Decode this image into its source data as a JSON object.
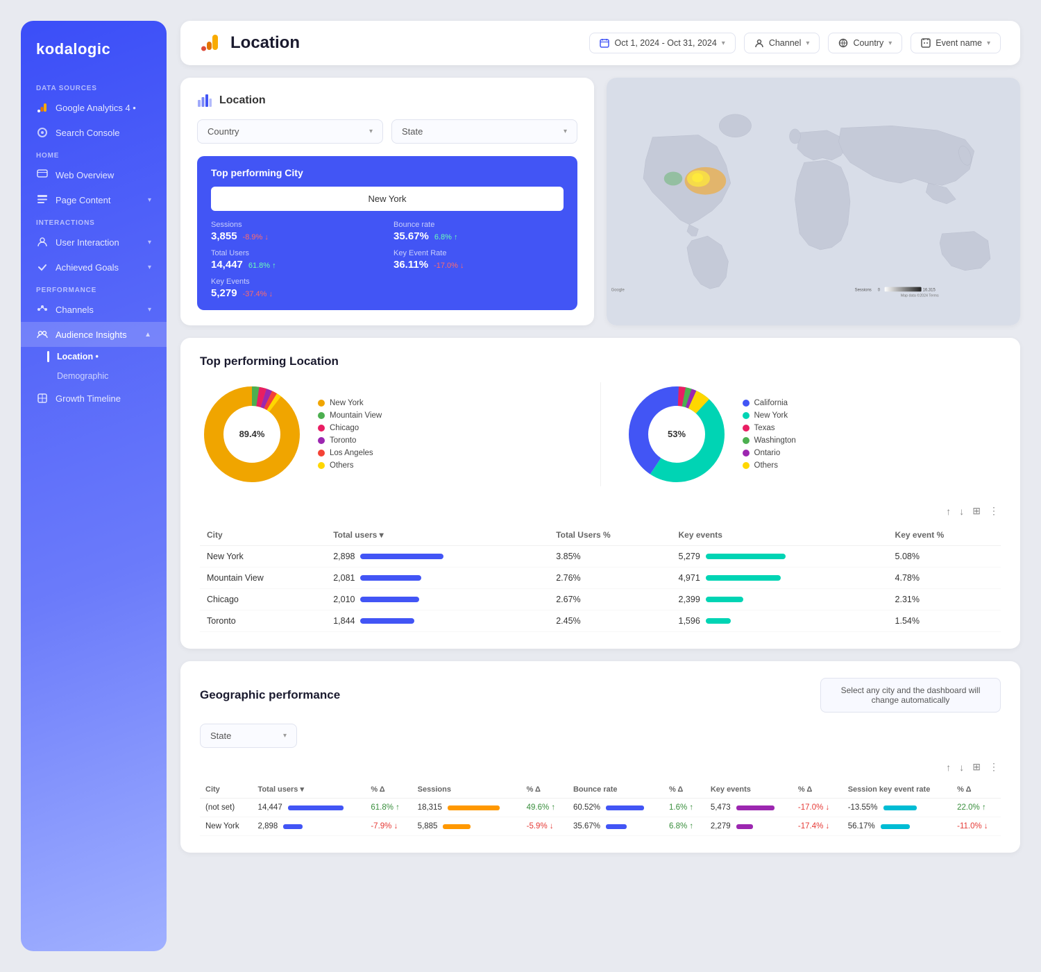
{
  "brand": "kodalogic",
  "sidebar": {
    "data_sources_label": "Data Sources",
    "google_analytics": "Google Analytics 4 •",
    "search_console": "Search Console",
    "home_label": "Home",
    "web_overview": "Web Overview",
    "page_content": "Page Content",
    "interactions_label": "Interactions",
    "user_interaction": "User Interaction",
    "achieved_goals": "Achieved Goals",
    "performance_label": "Performance",
    "channels": "Channels",
    "audience_insights": "Audience Insights",
    "location": "Location •",
    "demographic": "Demographic",
    "growth_timeline": "Growth Timeline"
  },
  "topbar": {
    "title": "Location",
    "filter_date": "Oct 1, 2024 - Oct 31, 2024",
    "filter_channel": "Channel",
    "filter_country": "Country",
    "filter_event": "Event name"
  },
  "location_card": {
    "title": "Location",
    "filter1": "Country",
    "filter2": "State",
    "top_city_label": "Top performing City",
    "city_name": "New York",
    "stats": [
      {
        "label": "Sessions",
        "value": "3,855",
        "change": "-8.9%",
        "dir": "down"
      },
      {
        "label": "Bounce rate",
        "value": "35.67%",
        "change": "6.8%",
        "dir": "up"
      },
      {
        "label": "Total Users",
        "value": "14,447",
        "change": "61.8%",
        "dir": "up"
      },
      {
        "label": "Key Event Rate",
        "value": "36.11%",
        "change": "-17.0%",
        "dir": "down"
      },
      {
        "label": "Key Events",
        "value": "5,279",
        "change": "-37.4%",
        "dir": "down"
      }
    ]
  },
  "map_legend": {
    "label_left": "Sessions",
    "val_left": "0",
    "val_right": "16,315"
  },
  "top_performing_location": {
    "title": "Top performing Location",
    "donut1": {
      "center_pct": "89.4%",
      "segments": [
        {
          "label": "New York",
          "color": "#f0a500",
          "pct": 89.4
        },
        {
          "label": "Mountain View",
          "color": "#4caf50",
          "pct": 3.5
        },
        {
          "label": "Chicago",
          "color": "#e91e63",
          "pct": 2.2
        },
        {
          "label": "Toronto",
          "color": "#9c27b0",
          "pct": 1.8
        },
        {
          "label": "Los Angeles",
          "color": "#f44336",
          "pct": 1.6
        },
        {
          "label": "Others",
          "color": "#ffd700",
          "pct": 1.5
        }
      ]
    },
    "donut2": {
      "center_pct": "53%",
      "segments": [
        {
          "label": "California",
          "color": "#4255f5",
          "pct": 37
        },
        {
          "label": "New York",
          "color": "#00d4b4",
          "pct": 53
        },
        {
          "label": "Texas",
          "color": "#e91e63",
          "pct": 2.1
        },
        {
          "label": "Washington",
          "color": "#4caf50",
          "pct": 1.8
        },
        {
          "label": "Ontario",
          "color": "#9c27b0",
          "pct": 1.5
        },
        {
          "label": "Others",
          "color": "#ffd700",
          "pct": 4.6
        }
      ]
    },
    "table": {
      "columns": [
        "City",
        "Total users ▾",
        "Total Users %",
        "Key events",
        "Key event %"
      ],
      "rows": [
        {
          "city": "New York",
          "users": 2898,
          "users_pct": "3.85%",
          "key_events": 5279,
          "key_pct": "5.08%",
          "users_bar_w": 120,
          "events_bar_w": 115
        },
        {
          "city": "Mountain View",
          "users": 2081,
          "users_pct": "2.76%",
          "key_events": 4971,
          "key_pct": "4.78%",
          "users_bar_w": 88,
          "events_bar_w": 108
        },
        {
          "city": "Chicago",
          "users": 2010,
          "users_pct": "2.67%",
          "key_events": 2399,
          "key_pct": "2.31%",
          "users_bar_w": 85,
          "events_bar_w": 54
        },
        {
          "city": "Toronto",
          "users": 1844,
          "users_pct": "2.45%",
          "key_events": 1596,
          "key_pct": "1.54%",
          "users_bar_w": 78,
          "events_bar_w": 36
        }
      ]
    }
  },
  "geographic_performance": {
    "title": "Geographic performance",
    "hint": "Select any city and the dashboard will change automatically",
    "filter": "State",
    "table": {
      "columns": [
        "City",
        "Total users ▾",
        "% Δ",
        "Sessions",
        "% Δ",
        "Bounce rate",
        "% Δ",
        "Key events",
        "% Δ",
        "Session key event rate",
        "% Δ"
      ],
      "rows": [
        {
          "city": "(not set)",
          "users": "14,447",
          "users_bar_w": 80,
          "users_bar_color": "geo-bar-blue",
          "users_pct": "61.8% ↑",
          "sessions": "18,315",
          "sessions_bar_w": 75,
          "sessions_bar_color": "geo-bar-orange",
          "sessions_pct": "49.6% ↑",
          "bounce": "60.52%",
          "bounce_bar_w": 60,
          "bounce_bar_color": "geo-bar-blue",
          "bounce_pct": "1.6% ↑",
          "key_events": "5,473",
          "key_bar_w": 55,
          "key_bar_color": "geo-bar-purple",
          "key_pct": "-17.0% ↓",
          "key_rate": "-13.55%",
          "key_rate_bar_w": 50,
          "key_rate_bar_color": "geo-bar-teal",
          "key_rate_pct": "22.0% ↑"
        },
        {
          "city": "New York",
          "users": "2,898",
          "users_bar_w": 30,
          "users_bar_color": "geo-bar-blue",
          "users_pct": "-7.9% ↓",
          "sessions": "5,885",
          "sessions_bar_w": 42,
          "sessions_bar_color": "geo-bar-orange",
          "sessions_pct": "-5.9% ↓",
          "bounce": "35.67%",
          "bounce_bar_w": 32,
          "bounce_bar_color": "geo-bar-blue",
          "bounce_pct": "6.8% ↑",
          "key_events": "2,279",
          "key_bar_w": 26,
          "key_bar_color": "geo-bar-purple",
          "key_pct": "-17.4% ↓",
          "key_rate": "56.17%",
          "key_rate_bar_w": 44,
          "key_rate_bar_color": "geo-bar-teal",
          "key_rate_pct": "-11.0% ↓"
        }
      ]
    }
  }
}
